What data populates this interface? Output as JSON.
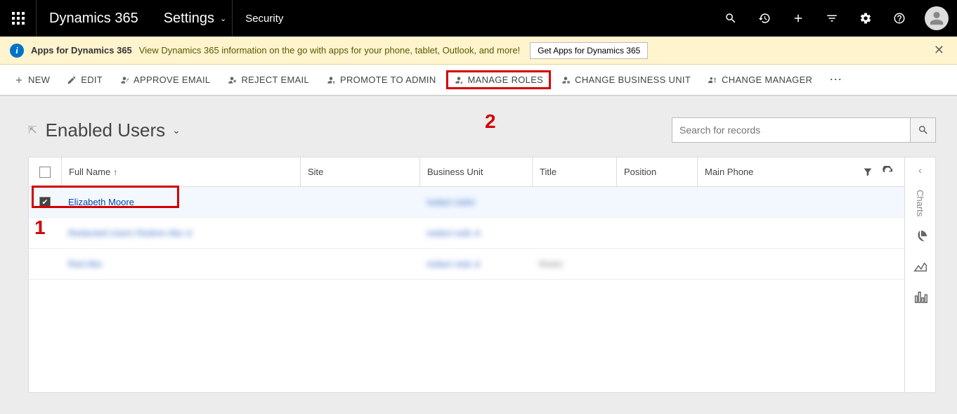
{
  "topbar": {
    "brand": "Dynamics 365",
    "area": "Settings",
    "subarea": "Security"
  },
  "notify": {
    "title": "Apps for Dynamics 365",
    "text": "View Dynamics 365 information on the go with apps for your phone, tablet, Outlook, and more!",
    "button": "Get Apps for Dynamics 365"
  },
  "cmdbar": {
    "new": "NEW",
    "edit": "EDIT",
    "approve": "APPROVE EMAIL",
    "reject": "REJECT EMAIL",
    "promote": "PROMOTE TO ADMIN",
    "manage_roles": "MANAGE ROLES",
    "change_bu": "CHANGE BUSINESS UNIT",
    "change_mgr": "CHANGE MANAGER"
  },
  "view": {
    "title": "Enabled Users",
    "search_placeholder": "Search for records"
  },
  "grid": {
    "cols": {
      "fullname": "Full Name",
      "site": "Site",
      "bu": "Business Unit",
      "title": "Title",
      "position": "Position",
      "phone": "Main Phone"
    },
    "rows": [
      {
        "selected": true,
        "name": "Elizabeth Moore",
        "bu": "redact redct",
        "title": ""
      },
      {
        "selected": false,
        "name": "Redacted Usern Rednm Abc d",
        "bu": "redact redc d",
        "title": ""
      },
      {
        "selected": false,
        "name": "Red Abc",
        "bu": "redact redc d",
        "title": "Redct"
      }
    ]
  },
  "chartpane": {
    "label": "Charts"
  },
  "annotations": {
    "one": "1",
    "two": "2"
  }
}
